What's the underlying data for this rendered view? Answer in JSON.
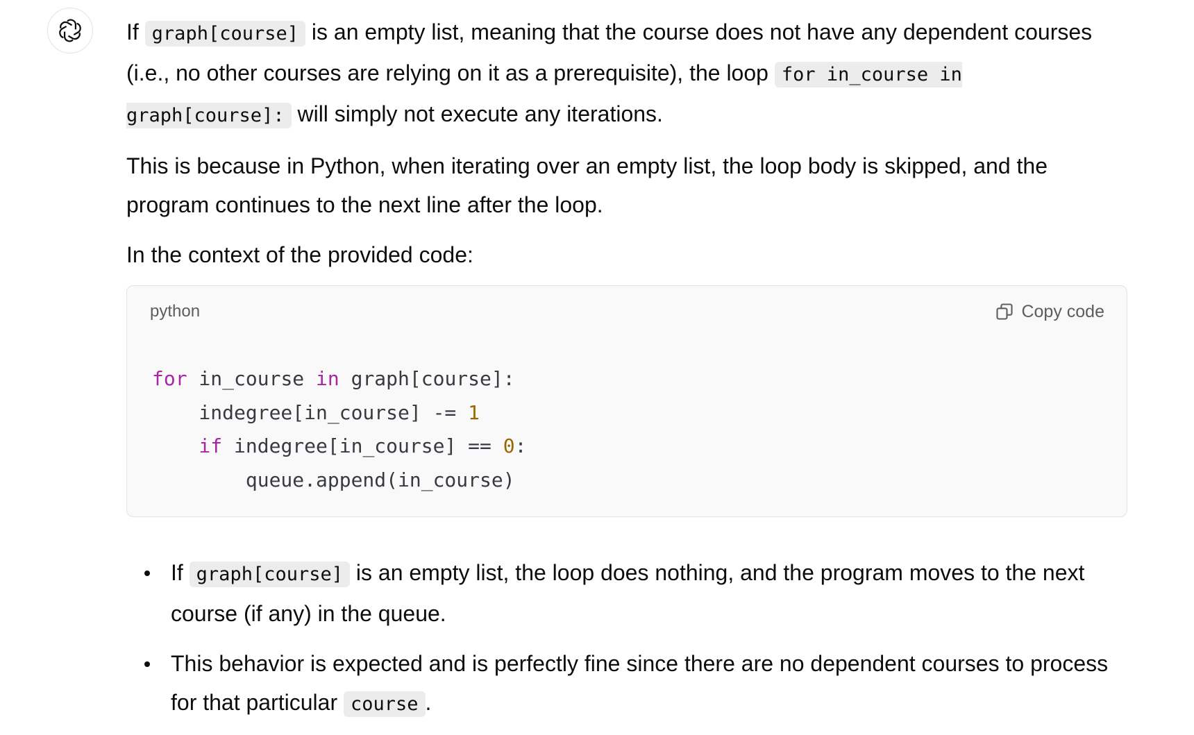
{
  "avatar": {
    "icon": "openai-logo-icon"
  },
  "message": {
    "p1": {
      "t1": "If ",
      "c1": "graph[course]",
      "t2": " is an empty list, meaning that the course does not have any dependent courses (i.e., no other courses are relying on it as a prerequisite), the loop ",
      "c2": "for in_course in graph[course]:",
      "t3": " will simply not execute any iterations."
    },
    "p2": "This is because in Python, when iterating over an empty list, the loop body is skipped, and the program continues to the next line after the loop.",
    "p3": "In the context of the provided code:",
    "code_block": {
      "language": "python",
      "copy_label": "Copy code",
      "lines": [
        {
          "kw": "for",
          "t1": " in_course ",
          "kw2": "in",
          "t2": " graph[course]:"
        },
        {
          "t1": "    indegree[in_course] -= ",
          "num": "1"
        },
        {
          "kw": "    if",
          "t1": " indegree[in_course] == ",
          "num": "0",
          "t2": ":"
        },
        {
          "t1": "        queue.append(in_course)"
        }
      ]
    },
    "bullets": [
      {
        "t1": "If ",
        "c1": "graph[course]",
        "t2": " is an empty list, the loop does nothing, and the program moves to the next course (if any) in the queue."
      },
      {
        "t1": "This behavior is expected and is perfectly fine since there are no dependent courses to process for that particular ",
        "c1": "course",
        "t2": "."
      }
    ]
  },
  "colors": {
    "keyword": "#a626a4",
    "number": "#986801",
    "code_bg": "#f9f9f9",
    "inline_code_bg": "#ececec"
  }
}
